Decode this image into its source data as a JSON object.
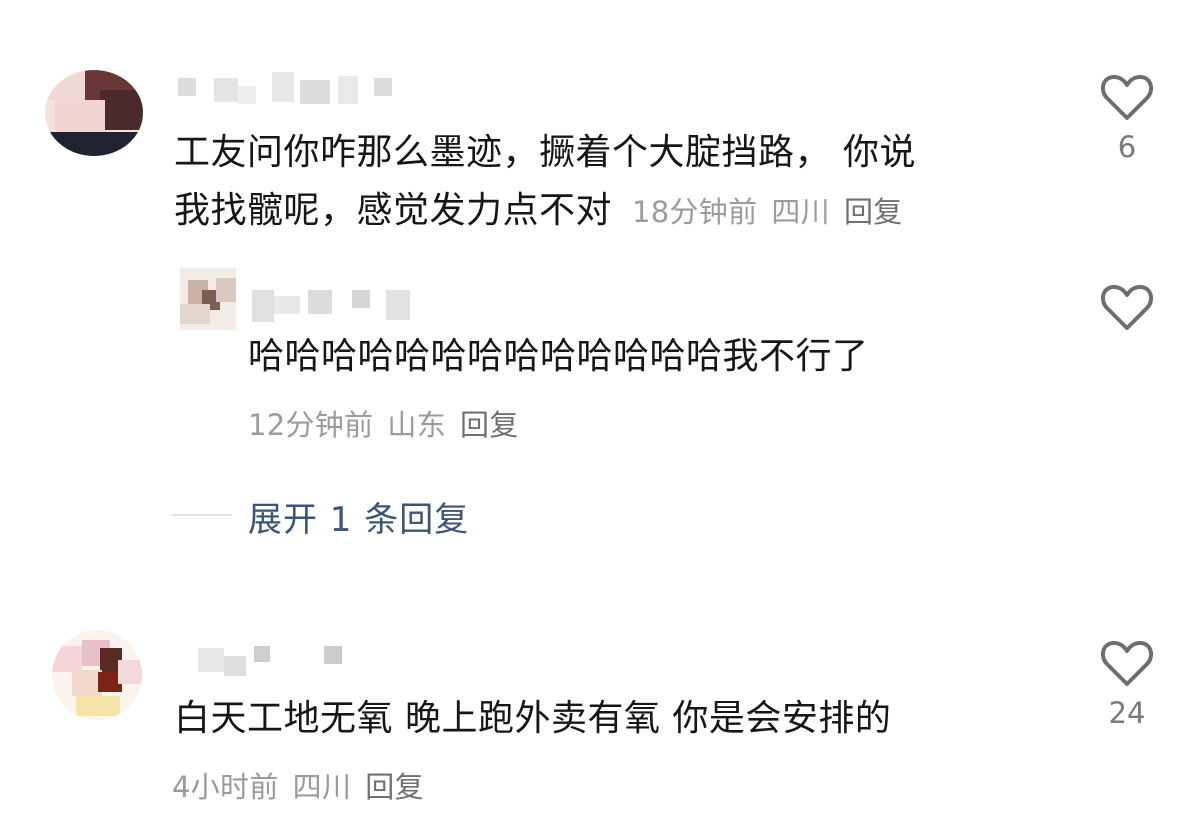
{
  "comments": [
    {
      "text_line1": "工友问你咋那么墨迹，撅着个大腚挡路，  你说",
      "text_line2": "我找髋呢，感觉发力点不对",
      "time": "18分钟前",
      "location": "四川",
      "reply_label": "回复",
      "likes": "6"
    },
    {
      "text": "白天工地无氧 晚上跑外卖有氧 你是会安排的",
      "time": "4小时前",
      "location": "四川",
      "reply_label": "回复",
      "likes": "24"
    }
  ],
  "reply": {
    "text": "哈哈哈哈哈哈哈哈哈哈哈哈哈我不行了",
    "time": "12分钟前",
    "location": "山东",
    "reply_label": "回复"
  },
  "expand": {
    "label": "展开 1 条回复"
  },
  "icons": {
    "like": "heart-outline-icon"
  },
  "colors": {
    "text": "#161616",
    "meta": "#9b9b9b",
    "expand": "#3c5577",
    "icon": "#6e6e6e"
  }
}
